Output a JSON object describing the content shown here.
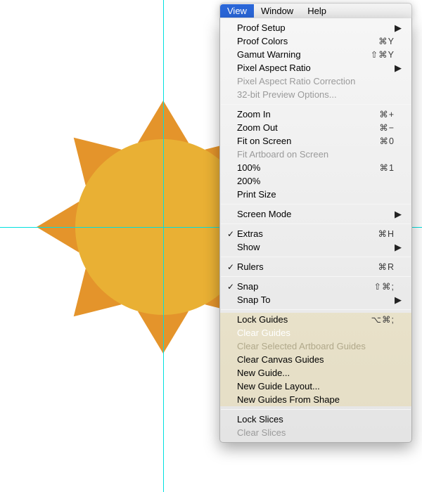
{
  "menubar": {
    "active": "View",
    "items": [
      "View",
      "Window",
      "Help"
    ]
  },
  "menu": {
    "sections": [
      [
        {
          "key": "proof_setup",
          "label": "Proof Setup",
          "submenu": true
        },
        {
          "key": "proof_colors",
          "label": "Proof Colors",
          "shortcut": "⌘Y"
        },
        {
          "key": "gamut_warning",
          "label": "Gamut Warning",
          "shortcut": "⇧⌘Y"
        },
        {
          "key": "pixel_aspect",
          "label": "Pixel Aspect Ratio",
          "submenu": true
        },
        {
          "key": "pixel_aspect_corr",
          "label": "Pixel Aspect Ratio Correction",
          "disabled": true
        },
        {
          "key": "preview32",
          "label": "32-bit Preview Options...",
          "disabled": true
        }
      ],
      [
        {
          "key": "zoom_in",
          "label": "Zoom In",
          "shortcut": "⌘+"
        },
        {
          "key": "zoom_out",
          "label": "Zoom Out",
          "shortcut": "⌘−"
        },
        {
          "key": "fit_screen",
          "label": "Fit on Screen",
          "shortcut": "⌘0"
        },
        {
          "key": "fit_artboard",
          "label": "Fit Artboard on Screen",
          "disabled": true
        },
        {
          "key": "p100",
          "label": "100%",
          "shortcut": "⌘1"
        },
        {
          "key": "p200",
          "label": "200%"
        },
        {
          "key": "print_size",
          "label": "Print Size"
        }
      ],
      [
        {
          "key": "screen_mode",
          "label": "Screen Mode",
          "submenu": true
        }
      ],
      [
        {
          "key": "extras",
          "label": "Extras",
          "checked": true,
          "shortcut": "⌘H"
        },
        {
          "key": "show",
          "label": "Show",
          "submenu": true
        }
      ],
      [
        {
          "key": "rulers",
          "label": "Rulers",
          "checked": true,
          "shortcut": "⌘R"
        }
      ],
      [
        {
          "key": "snap",
          "label": "Snap",
          "checked": true,
          "shortcut": "⇧⌘;"
        },
        {
          "key": "snap_to",
          "label": "Snap To",
          "submenu": true
        }
      ],
      [
        {
          "key": "lock_guides",
          "label": "Lock Guides",
          "shortcut": "⌥⌘;",
          "yellow": true
        },
        {
          "key": "clear_guides",
          "label": "Clear Guides",
          "selected": true,
          "yellow": true
        },
        {
          "key": "clear_sel_artboard",
          "label": "Clear Selected Artboard Guides",
          "disabled": true,
          "yellow": true
        },
        {
          "key": "clear_canvas",
          "label": "Clear Canvas Guides",
          "yellow": true
        },
        {
          "key": "new_guide",
          "label": "New Guide...",
          "yellow": true
        },
        {
          "key": "new_guide_layout",
          "label": "New Guide Layout...",
          "yellow": true
        },
        {
          "key": "new_guides_shape",
          "label": "New Guides From Shape",
          "yellow": true
        }
      ],
      [
        {
          "key": "lock_slices",
          "label": "Lock Slices"
        },
        {
          "key": "clear_slices",
          "label": "Clear Slices",
          "disabled": true
        }
      ]
    ]
  },
  "colors": {
    "circle": "#E9B034",
    "ray": "#E4942B",
    "guide": "#00e0e0",
    "selected": "#2f6ee0",
    "yellow_bg": "rgba(231,203,118,.28)"
  }
}
